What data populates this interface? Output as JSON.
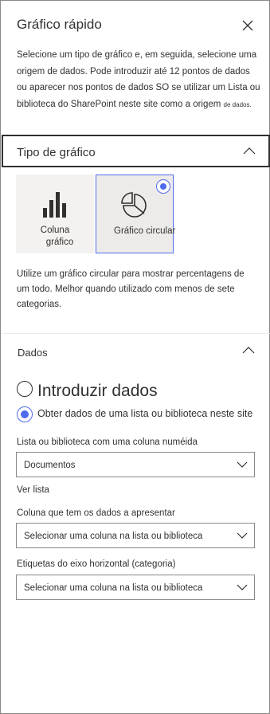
{
  "panel": {
    "title": "Gráfico rápido",
    "close_icon": "close-icon"
  },
  "intro": {
    "text": "Selecione um tipo de gráfico e, em seguida, selecione uma origem de dados. Pode introduzir até 12 pontos de dados ou aparecer nos pontos de dados SO se utilizar um Lista ou biblioteca do SharePoint neste site como a origem",
    "small_tail": "de dados."
  },
  "chart_type": {
    "header": "Tipo de gráfico",
    "tiles": [
      {
        "label_line1": "Coluna",
        "label_line2": "gráfico",
        "icon": "column-chart-icon",
        "selected": false
      },
      {
        "label": "Gráfico circular",
        "icon": "pie-chart-icon",
        "selected": true
      }
    ],
    "description": "Utilize um gráfico circular para mostrar percentagens de um todo. Melhor quando utilizado com menos de sete categorias."
  },
  "data": {
    "header": "Dados",
    "options": [
      {
        "label": "Introduzir dados",
        "selected": false
      },
      {
        "label": "Obter dados de uma lista ou biblioteca neste site",
        "selected": true
      }
    ],
    "list_label": "Lista ou biblioteca com uma coluna numéida",
    "list_value": "Documentos",
    "view_list": "Ver lista",
    "column_label": "Coluna que tem os dados a apresentar",
    "column_value": "Selecionar uma coluna na lista ou biblioteca",
    "axis_label": "Etiquetas do eixo horizontal (categoria)",
    "axis_value": "Selecionar uma coluna na lista ou biblioteca"
  },
  "colors": {
    "accent": "#4f6bed",
    "text": "#323130",
    "tile_bg": "#f3f2f1",
    "border": "#8a8886"
  }
}
